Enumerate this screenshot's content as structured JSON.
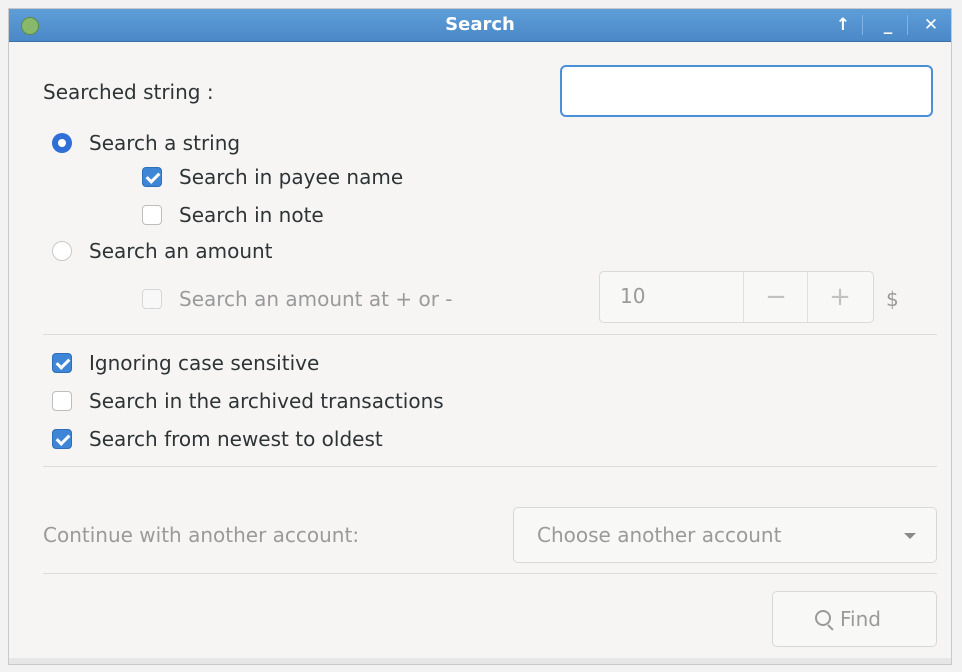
{
  "window": {
    "title": "Search",
    "icon": "app-icon",
    "buttons": {
      "maximize": "↑",
      "minimize": "_",
      "close": "✕"
    }
  },
  "search": {
    "label": "Searched string :",
    "value": "",
    "mode_string_label": "Search a string",
    "payee_label": "Search in payee name",
    "note_label": "Search in note",
    "mode_amount_label": "Search an amount",
    "amount_tolerance_label": "Search an amount at + or -",
    "amount_value": "10",
    "currency": "$",
    "mode_string_selected": true,
    "payee_checked": true,
    "note_checked": false,
    "amount_tolerance_checked": false
  },
  "options": {
    "ignore_case_label": "Ignoring case sensitive",
    "archived_label": "Search in the archived transactions",
    "newest_label": "Search from newest to oldest",
    "ignore_case_checked": true,
    "archived_checked": false,
    "newest_checked": true
  },
  "continue": {
    "label": "Continue with another account:",
    "combo_text": "Choose another account"
  },
  "find_button": {
    "label": "Find"
  },
  "colors": {
    "accent": "#3f87d6",
    "titlebar": "#4a88c7"
  }
}
